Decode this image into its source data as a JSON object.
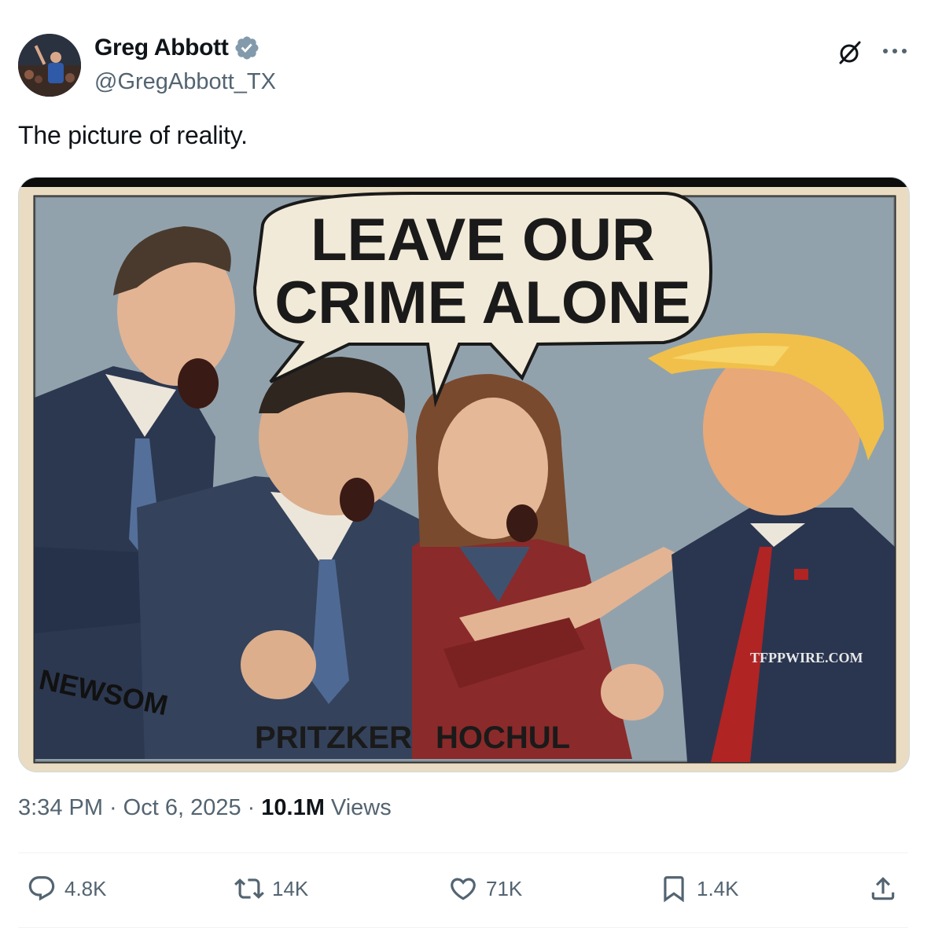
{
  "author": {
    "display_name": "Greg Abbott",
    "handle": "@GregAbbott_TX",
    "verified": true
  },
  "tweet": {
    "text": "The picture of reality."
  },
  "media": {
    "speech_bubble_line1": "LEAVE OUR",
    "speech_bubble_line2": "CRIME ALONE",
    "label_left": "NEWSOM",
    "label_center": "PRITZKER",
    "label_right": "HOCHUL",
    "watermark": "TFPPWIRE.COM"
  },
  "meta": {
    "time": "3:34 PM",
    "date": "Oct 6, 2025",
    "views_count": "10.1M",
    "views_label": "Views"
  },
  "actions": {
    "replies": "4.8K",
    "reposts": "14K",
    "likes": "71K",
    "bookmarks": "1.4K"
  },
  "colors": {
    "text_primary": "#0f1419",
    "text_secondary": "#536471",
    "verified_badge": "#829aab",
    "divider": "#eff3f4"
  },
  "icons": [
    "grok-icon",
    "more-icon",
    "reply-icon",
    "repost-icon",
    "like-icon",
    "bookmark-icon",
    "share-icon",
    "verified-badge-icon"
  ]
}
